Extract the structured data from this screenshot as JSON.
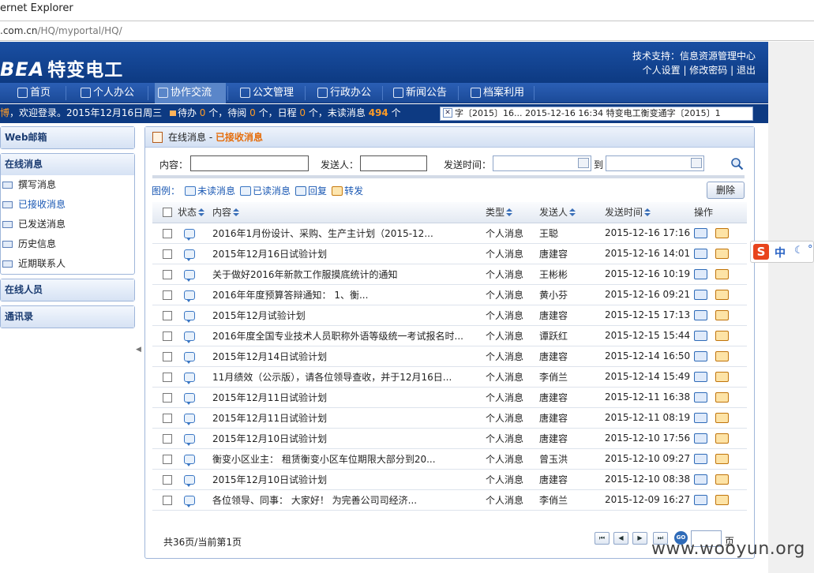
{
  "browser": {
    "title": "ernet Explorer",
    "url_host": ".com.cn",
    "url_path": "/HQ/myportal/HQ/"
  },
  "header": {
    "logo_en": "BEA",
    "logo_cn": "特变电工",
    "support": "技术支持：信息资源管理中心",
    "links": [
      "个人设置",
      "修改密码",
      "退出"
    ]
  },
  "nav": {
    "items": [
      {
        "label": "首页",
        "icon": "home-icon"
      },
      {
        "label": "个人办公",
        "icon": "person-icon"
      },
      {
        "label": "协作交流",
        "icon": "chat-icon"
      },
      {
        "label": "公文管理",
        "icon": "document-icon"
      },
      {
        "label": "行政办公",
        "icon": "folder-icon"
      },
      {
        "label": "新闻公告",
        "icon": "speaker-icon"
      },
      {
        "label": "档案利用",
        "icon": "archive-icon"
      }
    ],
    "active": "协作交流"
  },
  "infobar": {
    "greeting": "博，欢迎登录。2015年12月16日周三",
    "todo_label": "待办",
    "todo_count": "0",
    "todo_unit": "个，待阅",
    "read_count": "0",
    "read_unit": "个，日程",
    "sched_count": "0",
    "sched_unit": "个，未读消息",
    "unread_count": "494",
    "unread_unit": "个"
  },
  "ticker": {
    "text": "字〔2015〕16...        2015-12-16 16:34  特变电工衡变通字〔2015〕1"
  },
  "sidebar": {
    "webmail": "Web邮箱",
    "online_msg": "在线消息",
    "items": [
      "撰写消息",
      "已接收消息",
      "已发送消息",
      "历史信息",
      "近期联系人"
    ],
    "online_users": "在线人员",
    "contacts": "通讯录"
  },
  "panel": {
    "title": "在线消息 - ",
    "subtitle": "已接收消息",
    "search": {
      "content_label": "内容：",
      "sender_label": "发送人：",
      "time_label": "发送时间：",
      "to_label": "到"
    },
    "legend": {
      "label": "图例：",
      "unread": "未读消息",
      "read": "已读消息",
      "reply": "回复",
      "forward": "转发"
    },
    "delete_label": "删除",
    "columns": [
      "状态",
      "内容",
      "类型",
      "发送人",
      "发送时间",
      "操作"
    ],
    "rows": [
      {
        "content": "2016年1月份设计、采购、生产主计划（2015-12...",
        "type": "个人消息",
        "sender": "王聪",
        "time": "2015-12-16 17:16"
      },
      {
        "content": "2015年12月16日试验计划",
        "type": "个人消息",
        "sender": "唐建容",
        "time": "2015-12-16 14:01"
      },
      {
        "content": "关于做好2016年新款工作服摸底统计的通知",
        "type": "个人消息",
        "sender": "王彬彬",
        "time": "2015-12-16 10:19"
      },
      {
        "content": "2016年年度预算答辩通知： 1、衡...",
        "type": "个人消息",
        "sender": "黄小芬",
        "time": "2015-12-16 09:21"
      },
      {
        "content": "2015年12月试验计划",
        "type": "个人消息",
        "sender": "唐建容",
        "time": "2015-12-15 17:13"
      },
      {
        "content": "2016年度全国专业技术人员职称外语等级统一考试报名时...",
        "type": "个人消息",
        "sender": "谭跃红",
        "time": "2015-12-15 15:44"
      },
      {
        "content": "2015年12月14日试验计划",
        "type": "个人消息",
        "sender": "唐建容",
        "time": "2015-12-14 16:50"
      },
      {
        "content": "11月绩效（公示版），请各位领导查收，并于12月16日...",
        "type": "个人消息",
        "sender": "李俏兰",
        "time": "2015-12-14 15:49"
      },
      {
        "content": "2015年12月11日试验计划",
        "type": "个人消息",
        "sender": "唐建容",
        "time": "2015-12-11 16:38"
      },
      {
        "content": "2015年12月11日试验计划",
        "type": "个人消息",
        "sender": "唐建容",
        "time": "2015-12-11 08:19"
      },
      {
        "content": "2015年12月10日试验计划",
        "type": "个人消息",
        "sender": "唐建容",
        "time": "2015-12-10 17:56"
      },
      {
        "content": "衡变小区业主： 租赁衡变小区车位期限大部分到20...",
        "type": "个人消息",
        "sender": "曾玉洪",
        "time": "2015-12-10 09:27"
      },
      {
        "content": "2015年12月10日试验计划",
        "type": "个人消息",
        "sender": "唐建容",
        "time": "2015-12-10 08:38"
      },
      {
        "content": "各位领导、同事： 大家好！ 为完善公司司经济...",
        "type": "个人消息",
        "sender": "李俏兰",
        "time": "2015-12-09 16:27"
      }
    ],
    "pager": {
      "summary": "共36页/当前第1页",
      "go": "GO",
      "page_word": "页"
    }
  },
  "ime": {
    "logo": "S",
    "mode": "中"
  },
  "watermark": "www.wooyun.org",
  "colors": {
    "brand_blue": "#0d3a82",
    "orange": "#e56d0b",
    "link_blue": "#1a58b3"
  }
}
